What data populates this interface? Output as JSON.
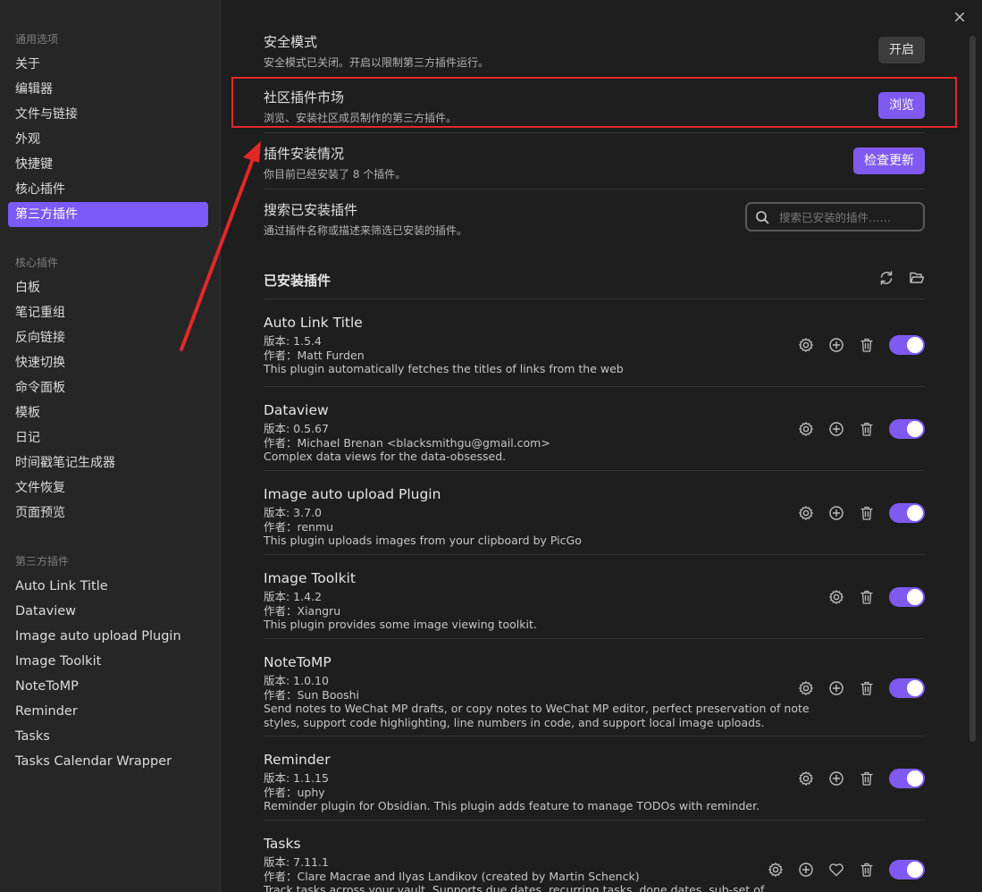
{
  "sidebar": {
    "sections": [
      {
        "title": "通用选项",
        "items": [
          "关于",
          "编辑器",
          "文件与链接",
          "外观",
          "快捷键",
          "核心插件",
          "第三方插件"
        ]
      },
      {
        "title": "核心插件",
        "items": [
          "白板",
          "笔记重组",
          "反向链接",
          "快速切换",
          "命令面板",
          "模板",
          "日记",
          "时间戳笔记生成器",
          "文件恢复",
          "页面预览"
        ]
      },
      {
        "title": "第三方插件",
        "items": [
          "Auto Link Title",
          "Dataview",
          "Image auto upload Plugin",
          "Image Toolkit",
          "NoteToMP",
          "Reminder",
          "Tasks",
          "Tasks Calendar Wrapper"
        ]
      }
    ]
  },
  "safe_mode": {
    "name": "安全模式",
    "desc": "安全模式已关闭。开启以限制第三方插件运行。",
    "button": "开启"
  },
  "community": {
    "name": "社区插件市场",
    "desc": "浏览、安装社区成员制作的第三方插件。",
    "button": "浏览"
  },
  "install_status": {
    "name": "插件安装情况",
    "desc": "你目前已经安装了 8 个插件。",
    "button": "检查更新"
  },
  "search": {
    "name": "搜索已安装插件",
    "desc": "通过插件名称或描述来筛选已安装的插件。",
    "placeholder": "搜索已安装的插件……"
  },
  "installed": {
    "title": "已安装插件"
  },
  "plugins": [
    {
      "name": "Auto Link Title",
      "version": "版本: 1.5.4",
      "author": "作者：Matt Furden",
      "desc": [
        "This plugin automatically fetches the titles of links from the web"
      ],
      "icons": [
        "gear",
        "plus",
        "trash"
      ]
    },
    {
      "name": "Dataview",
      "version": "版本: 0.5.67",
      "author": "作者：Michael Brenan <blacksmithgu@gmail.com>",
      "desc": [
        "Complex data views for the data-obsessed."
      ],
      "icons": [
        "gear",
        "plus",
        "trash"
      ]
    },
    {
      "name": "Image auto upload Plugin",
      "version": "版本: 3.7.0",
      "author": "作者：renmu",
      "desc": [
        "This plugin uploads images from your clipboard by PicGo"
      ],
      "icons": [
        "gear",
        "plus",
        "trash"
      ]
    },
    {
      "name": "Image Toolkit",
      "version": "版本: 1.4.2",
      "author": "作者：Xiangru",
      "desc": [
        "This plugin provides some image viewing toolkit."
      ],
      "icons": [
        "gear",
        "trash"
      ]
    },
    {
      "name": "NoteToMP",
      "version": "版本: 1.0.10",
      "author": "作者：Sun Booshi",
      "desc": [
        "Send notes to WeChat MP drafts, or copy notes to WeChat MP editor, perfect preservation of note",
        "styles, support code highlighting, line numbers in code, and support local image uploads."
      ],
      "icons": [
        "gear",
        "plus",
        "trash"
      ]
    },
    {
      "name": "Reminder",
      "version": "版本: 1.1.15",
      "author": "作者：uphy",
      "desc": [
        "Reminder plugin for Obsidian. This plugin adds feature to manage TODOs with reminder."
      ],
      "icons": [
        "gear",
        "plus",
        "trash"
      ]
    },
    {
      "name": "Tasks",
      "version": "版本: 7.11.1",
      "author": "作者：Clare Macrae and Ilyas Landikov (created by Martin Schenck)",
      "desc": [
        "Track tasks across your vault. Supports due dates, recurring tasks, done dates, sub-set of"
      ],
      "icons": [
        "gear",
        "plus",
        "heart",
        "trash"
      ]
    }
  ]
}
